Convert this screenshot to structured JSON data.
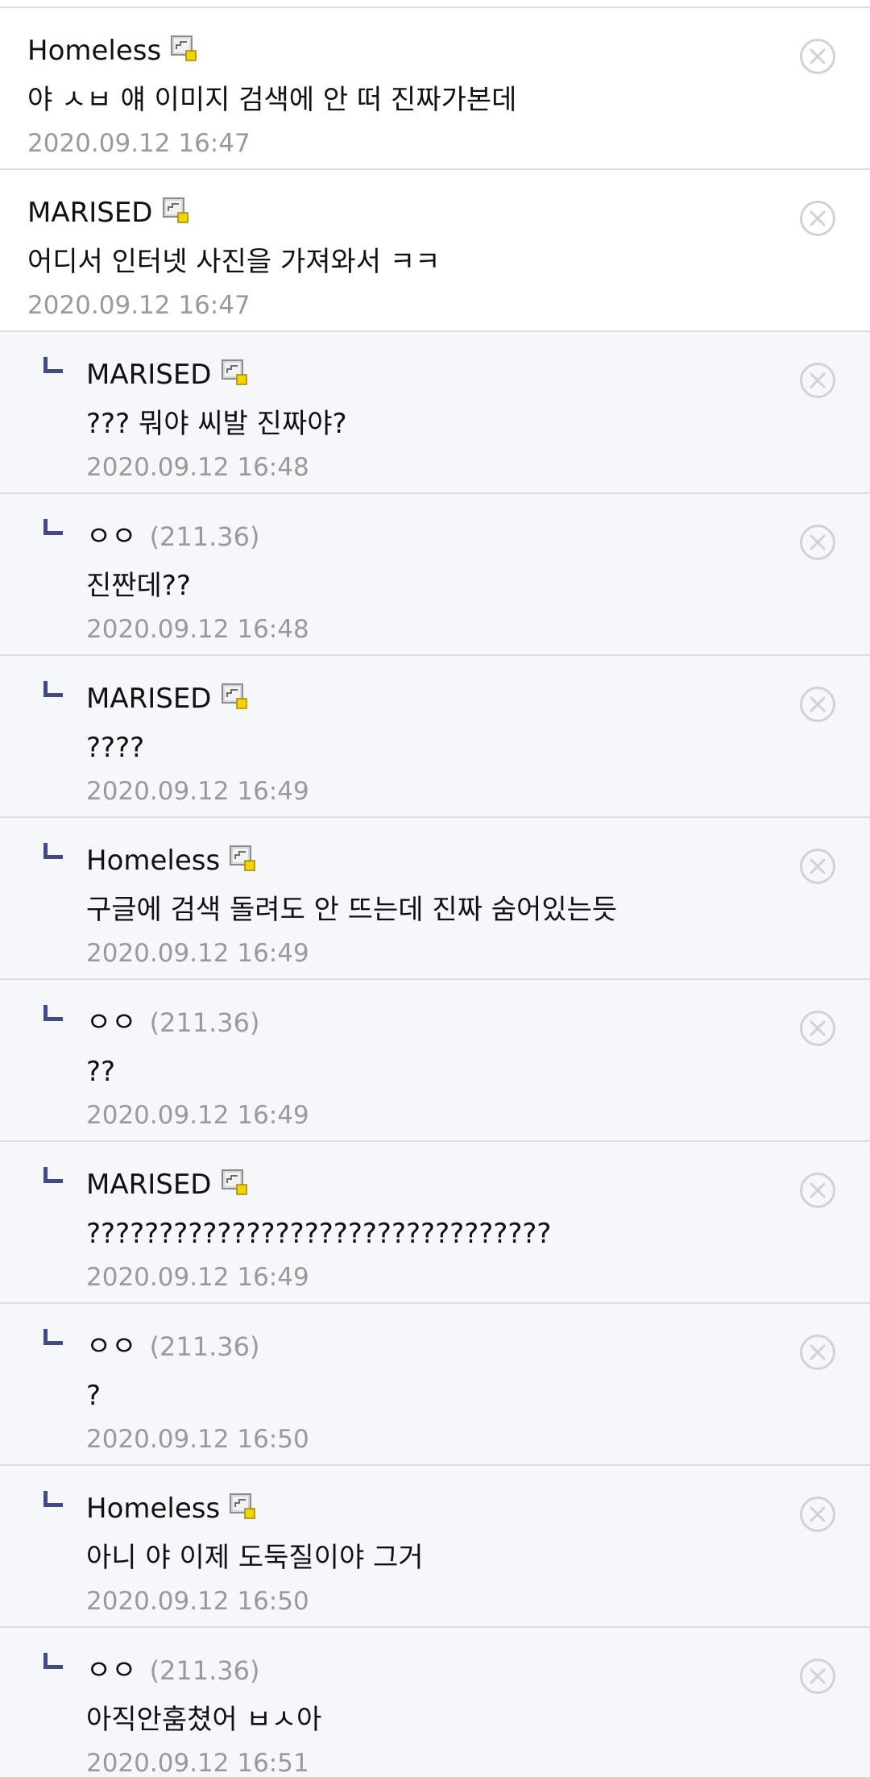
{
  "comments": [
    {
      "nick": "Homeless",
      "ip": "",
      "badge": true,
      "reply": false,
      "text": "야 ㅅㅂ 얘 이미지 검색에 안 떠 진짜가본데",
      "date": "2020.09.12 16:47"
    },
    {
      "nick": "MARISED",
      "ip": "",
      "badge": true,
      "reply": false,
      "text": "어디서 인터넷 사진을 가져와서 ㅋㅋ",
      "date": "2020.09.12 16:47"
    },
    {
      "nick": "MARISED",
      "ip": "",
      "badge": true,
      "reply": true,
      "text": "??? 뭐야 씨발 진짜야?",
      "date": "2020.09.12 16:48"
    },
    {
      "nick": "ㅇㅇ",
      "ip": "(211.36)",
      "badge": false,
      "reply": true,
      "text": "진짠데??",
      "date": "2020.09.12 16:48"
    },
    {
      "nick": "MARISED",
      "ip": "",
      "badge": true,
      "reply": true,
      "text": "????",
      "date": "2020.09.12 16:49"
    },
    {
      "nick": "Homeless",
      "ip": "",
      "badge": true,
      "reply": true,
      "text": "구글에 검색 돌려도 안 뜨는데 진짜 숨어있는듯",
      "date": "2020.09.12 16:49"
    },
    {
      "nick": "ㅇㅇ",
      "ip": "(211.36)",
      "badge": false,
      "reply": true,
      "text": "??",
      "date": "2020.09.12 16:49"
    },
    {
      "nick": "MARISED",
      "ip": "",
      "badge": true,
      "reply": true,
      "text": "????????????????????????????????",
      "date": "2020.09.12 16:49"
    },
    {
      "nick": "ㅇㅇ",
      "ip": "(211.36)",
      "badge": false,
      "reply": true,
      "text": "?",
      "date": "2020.09.12 16:50"
    },
    {
      "nick": "Homeless",
      "ip": "",
      "badge": true,
      "reply": true,
      "text": "아니 야 이제 도둑질이야 그거",
      "date": "2020.09.12 16:50"
    },
    {
      "nick": "ㅇㅇ",
      "ip": "(211.36)",
      "badge": false,
      "reply": true,
      "text": "아직안훔쳤어 ㅂㅅ아",
      "date": "2020.09.12 16:51"
    }
  ],
  "icons": {
    "badge": "gallery-manager-icon",
    "delete": "close-circle-icon",
    "reply": "reply-arrow-icon"
  },
  "colors": {
    "reply_background": "#f6f7fb",
    "reply_arrow": "#3f4a86",
    "divider": "#dcdde3",
    "meta_text": "#9a9a9a"
  }
}
